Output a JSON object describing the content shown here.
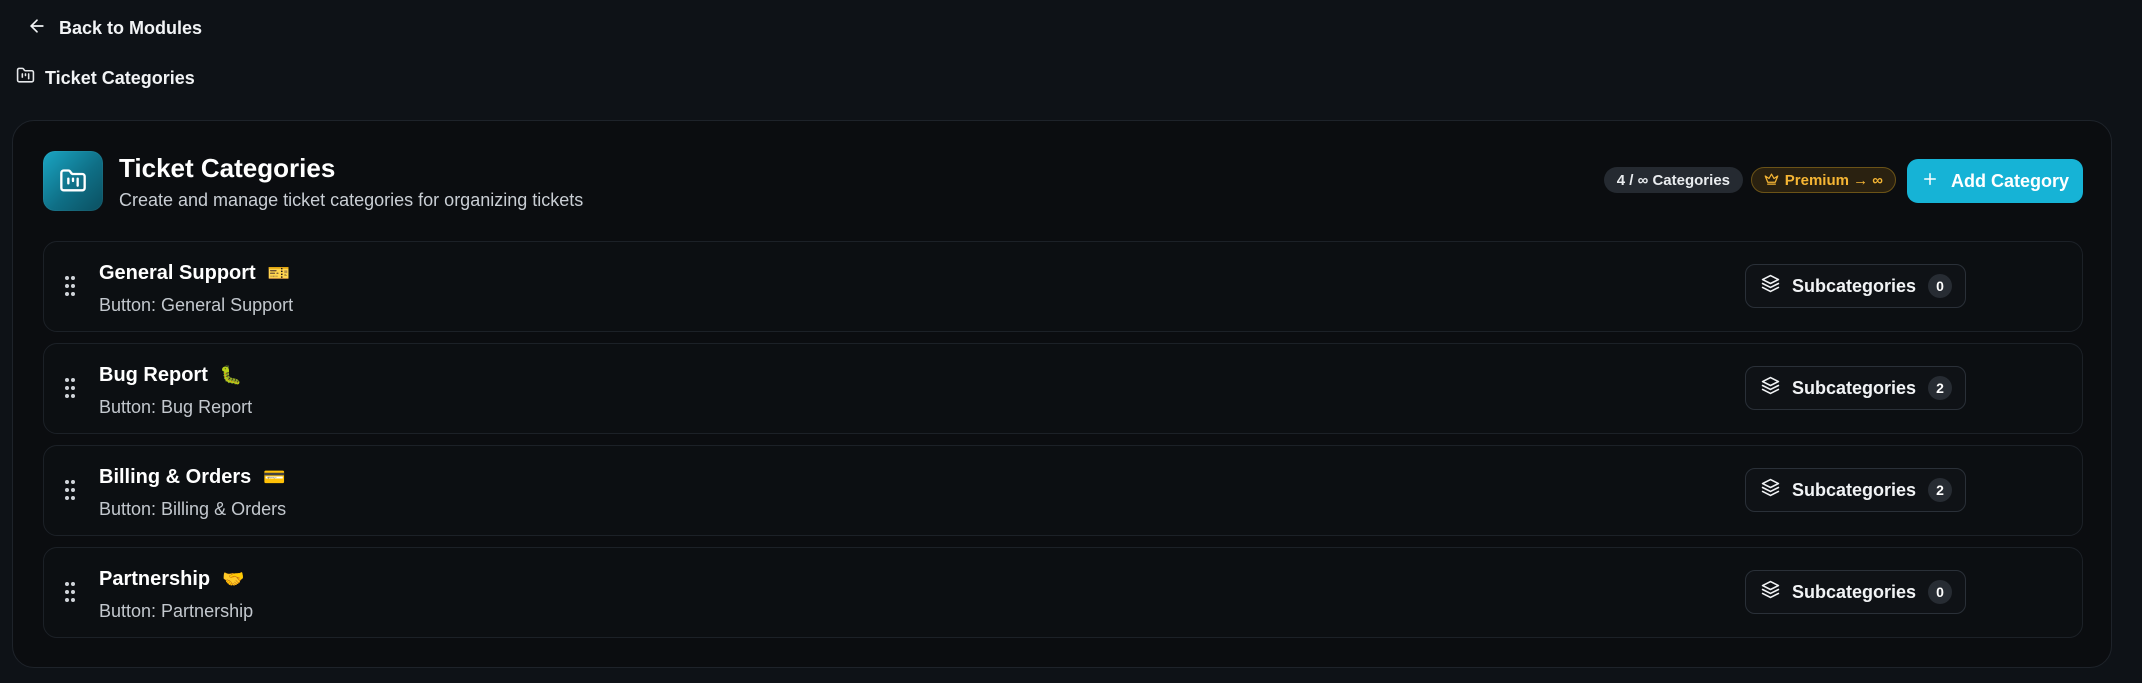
{
  "nav": {
    "back_label": "Back to Modules"
  },
  "breadcrumb": {
    "label": "Ticket Categories"
  },
  "header": {
    "title": "Ticket Categories",
    "subtitle": "Create and manage ticket categories for organizing tickets",
    "count_badge": "4 / ∞ Categories",
    "premium_badge": "Premium → ∞",
    "add_button": "Add Category"
  },
  "categories": [
    {
      "name": "General Support",
      "emoji": "🎫",
      "button_label": "Button: General Support",
      "subcategories_label": "Subcategories",
      "subcategory_count": "0"
    },
    {
      "name": "Bug Report",
      "emoji": "🐛",
      "button_label": "Button: Bug Report",
      "subcategories_label": "Subcategories",
      "subcategory_count": "2"
    },
    {
      "name": "Billing & Orders",
      "emoji": "💳",
      "button_label": "Button: Billing & Orders",
      "subcategories_label": "Subcategories",
      "subcategory_count": "2"
    },
    {
      "name": "Partnership",
      "emoji": "🤝",
      "button_label": "Button: Partnership",
      "subcategories_label": "Subcategories",
      "subcategory_count": "0"
    }
  ],
  "colors": {
    "background": "#0e1217",
    "card": "#0b0d10",
    "accent": "#16b3d6",
    "premium": "#f5b534"
  },
  "icons": {
    "back": "arrow-left-icon",
    "breadcrumb": "folder-kanban-icon",
    "header": "folder-kanban-icon",
    "premium": "crown-icon",
    "add": "plus-icon",
    "drag": "grip-vertical-icon",
    "subcategories": "layers-icon"
  }
}
